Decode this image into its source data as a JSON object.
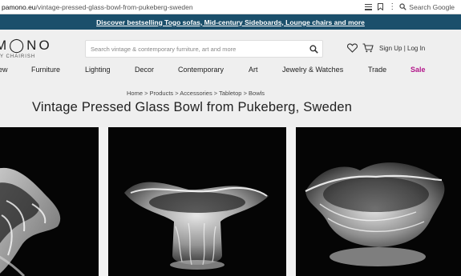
{
  "browser": {
    "url_domain": "pamono.eu",
    "url_path": "/vintage-pressed-glass-bowl-from-pukeberg-sweden",
    "search_placeholder": "Search Google"
  },
  "promo": {
    "text": "Discover bestselling Togo sofas, Mid-century Sideboards, Lounge chairs and more"
  },
  "header": {
    "logo": "M◯NO",
    "logo_sub": "Y CHAIRISH",
    "search_placeholder": "Search vintage & contemporary furniture, art and more",
    "sign_up": "Sign Up",
    "separator": "|",
    "log_in": "Log In"
  },
  "nav": {
    "items": [
      "ew",
      "Furniture",
      "Lighting",
      "Decor",
      "Contemporary",
      "Art",
      "Jewelry & Watches",
      "Trade",
      "Sale"
    ]
  },
  "breadcrumb": {
    "text": "Home > Products > Accessories > Tabletop > Bowls"
  },
  "page": {
    "title": "Vintage Pressed Glass Bowl from Pukeberg, Sweden"
  },
  "colors": {
    "promo_bg": "#1b4f6b",
    "header_bg": "#efefef",
    "sale": "#b3178a"
  }
}
